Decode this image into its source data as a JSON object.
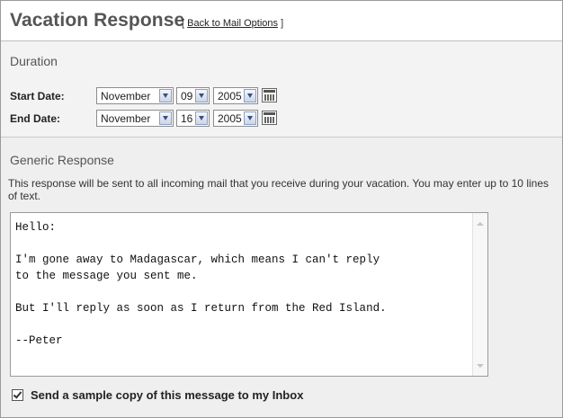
{
  "header": {
    "title": "Vacation Response",
    "back_open": "[",
    "back_link": "Back to Mail Options",
    "back_close": "]"
  },
  "duration": {
    "title": "Duration",
    "start_label": "Start Date:",
    "end_label": "End Date:",
    "start": {
      "month": "November",
      "day": "09",
      "year": "2005"
    },
    "end": {
      "month": "November",
      "day": "16",
      "year": "2005"
    }
  },
  "generic": {
    "title": "Generic Response",
    "description": "This response will be sent to all incoming mail that you receive during your vacation. You may enter up to 10 lines of text.",
    "message": "Hello:\n\nI'm gone away to Madagascar, which means I can't reply\nto the message you sent me.\n\nBut I'll reply as soon as I return from the Red Island.\n\n--Peter",
    "sample_copy_label": "Send a sample copy of this message to my Inbox",
    "sample_copy_checked": true
  },
  "icons": {
    "calendar": "calendar-icon",
    "dropdown": "chevron-down-icon",
    "checkbox": "checkbox-checked-icon"
  }
}
